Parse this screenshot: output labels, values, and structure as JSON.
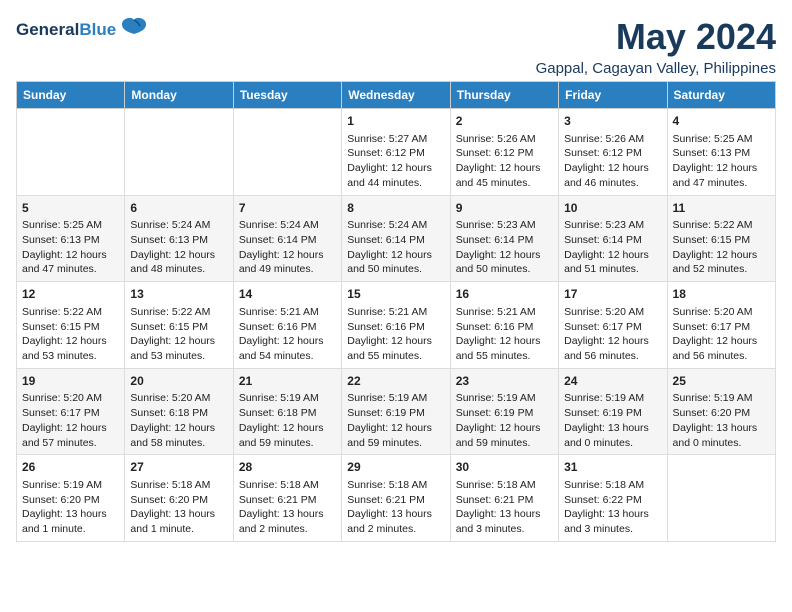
{
  "logo": {
    "general": "General",
    "blue": "Blue"
  },
  "title": "May 2024",
  "subtitle": "Gappal, Cagayan Valley, Philippines",
  "headers": [
    "Sunday",
    "Monday",
    "Tuesday",
    "Wednesday",
    "Thursday",
    "Friday",
    "Saturday"
  ],
  "weeks": [
    [
      {
        "day": "",
        "info": ""
      },
      {
        "day": "",
        "info": ""
      },
      {
        "day": "",
        "info": ""
      },
      {
        "day": "1",
        "info": "Sunrise: 5:27 AM\nSunset: 6:12 PM\nDaylight: 12 hours\nand 44 minutes."
      },
      {
        "day": "2",
        "info": "Sunrise: 5:26 AM\nSunset: 6:12 PM\nDaylight: 12 hours\nand 45 minutes."
      },
      {
        "day": "3",
        "info": "Sunrise: 5:26 AM\nSunset: 6:12 PM\nDaylight: 12 hours\nand 46 minutes."
      },
      {
        "day": "4",
        "info": "Sunrise: 5:25 AM\nSunset: 6:13 PM\nDaylight: 12 hours\nand 47 minutes."
      }
    ],
    [
      {
        "day": "5",
        "info": "Sunrise: 5:25 AM\nSunset: 6:13 PM\nDaylight: 12 hours\nand 47 minutes."
      },
      {
        "day": "6",
        "info": "Sunrise: 5:24 AM\nSunset: 6:13 PM\nDaylight: 12 hours\nand 48 minutes."
      },
      {
        "day": "7",
        "info": "Sunrise: 5:24 AM\nSunset: 6:14 PM\nDaylight: 12 hours\nand 49 minutes."
      },
      {
        "day": "8",
        "info": "Sunrise: 5:24 AM\nSunset: 6:14 PM\nDaylight: 12 hours\nand 50 minutes."
      },
      {
        "day": "9",
        "info": "Sunrise: 5:23 AM\nSunset: 6:14 PM\nDaylight: 12 hours\nand 50 minutes."
      },
      {
        "day": "10",
        "info": "Sunrise: 5:23 AM\nSunset: 6:14 PM\nDaylight: 12 hours\nand 51 minutes."
      },
      {
        "day": "11",
        "info": "Sunrise: 5:22 AM\nSunset: 6:15 PM\nDaylight: 12 hours\nand 52 minutes."
      }
    ],
    [
      {
        "day": "12",
        "info": "Sunrise: 5:22 AM\nSunset: 6:15 PM\nDaylight: 12 hours\nand 53 minutes."
      },
      {
        "day": "13",
        "info": "Sunrise: 5:22 AM\nSunset: 6:15 PM\nDaylight: 12 hours\nand 53 minutes."
      },
      {
        "day": "14",
        "info": "Sunrise: 5:21 AM\nSunset: 6:16 PM\nDaylight: 12 hours\nand 54 minutes."
      },
      {
        "day": "15",
        "info": "Sunrise: 5:21 AM\nSunset: 6:16 PM\nDaylight: 12 hours\nand 55 minutes."
      },
      {
        "day": "16",
        "info": "Sunrise: 5:21 AM\nSunset: 6:16 PM\nDaylight: 12 hours\nand 55 minutes."
      },
      {
        "day": "17",
        "info": "Sunrise: 5:20 AM\nSunset: 6:17 PM\nDaylight: 12 hours\nand 56 minutes."
      },
      {
        "day": "18",
        "info": "Sunrise: 5:20 AM\nSunset: 6:17 PM\nDaylight: 12 hours\nand 56 minutes."
      }
    ],
    [
      {
        "day": "19",
        "info": "Sunrise: 5:20 AM\nSunset: 6:17 PM\nDaylight: 12 hours\nand 57 minutes."
      },
      {
        "day": "20",
        "info": "Sunrise: 5:20 AM\nSunset: 6:18 PM\nDaylight: 12 hours\nand 58 minutes."
      },
      {
        "day": "21",
        "info": "Sunrise: 5:19 AM\nSunset: 6:18 PM\nDaylight: 12 hours\nand 59 minutes."
      },
      {
        "day": "22",
        "info": "Sunrise: 5:19 AM\nSunset: 6:19 PM\nDaylight: 12 hours\nand 59 minutes."
      },
      {
        "day": "23",
        "info": "Sunrise: 5:19 AM\nSunset: 6:19 PM\nDaylight: 12 hours\nand 59 minutes."
      },
      {
        "day": "24",
        "info": "Sunrise: 5:19 AM\nSunset: 6:19 PM\nDaylight: 13 hours\nand 0 minutes."
      },
      {
        "day": "25",
        "info": "Sunrise: 5:19 AM\nSunset: 6:20 PM\nDaylight: 13 hours\nand 0 minutes."
      }
    ],
    [
      {
        "day": "26",
        "info": "Sunrise: 5:19 AM\nSunset: 6:20 PM\nDaylight: 13 hours\nand 1 minute."
      },
      {
        "day": "27",
        "info": "Sunrise: 5:18 AM\nSunset: 6:20 PM\nDaylight: 13 hours\nand 1 minute."
      },
      {
        "day": "28",
        "info": "Sunrise: 5:18 AM\nSunset: 6:21 PM\nDaylight: 13 hours\nand 2 minutes."
      },
      {
        "day": "29",
        "info": "Sunrise: 5:18 AM\nSunset: 6:21 PM\nDaylight: 13 hours\nand 2 minutes."
      },
      {
        "day": "30",
        "info": "Sunrise: 5:18 AM\nSunset: 6:21 PM\nDaylight: 13 hours\nand 3 minutes."
      },
      {
        "day": "31",
        "info": "Sunrise: 5:18 AM\nSunset: 6:22 PM\nDaylight: 13 hours\nand 3 minutes."
      },
      {
        "day": "",
        "info": ""
      }
    ]
  ]
}
